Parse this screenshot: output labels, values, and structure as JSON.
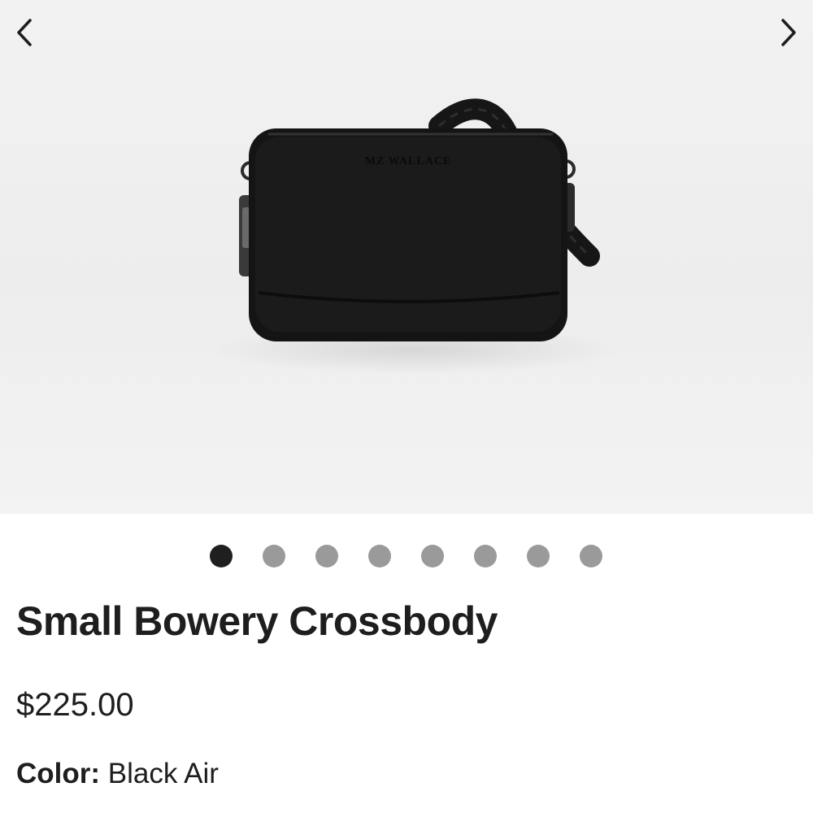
{
  "gallery": {
    "prev_icon": "chevron-left-icon",
    "next_icon": "chevron-right-icon",
    "image_brand_text": "MZ WALLACE",
    "total_images": 8,
    "active_index": 0
  },
  "product": {
    "title": "Small Bowery Crossbody",
    "price": "$225.00",
    "color_label": "Color:",
    "color_value": "Black Air"
  },
  "colors": {
    "text": "#1e1e1e",
    "dot_active": "#1f1f1f",
    "dot_inactive": "#9a9a9a",
    "gallery_bg": "#eeeeee"
  }
}
